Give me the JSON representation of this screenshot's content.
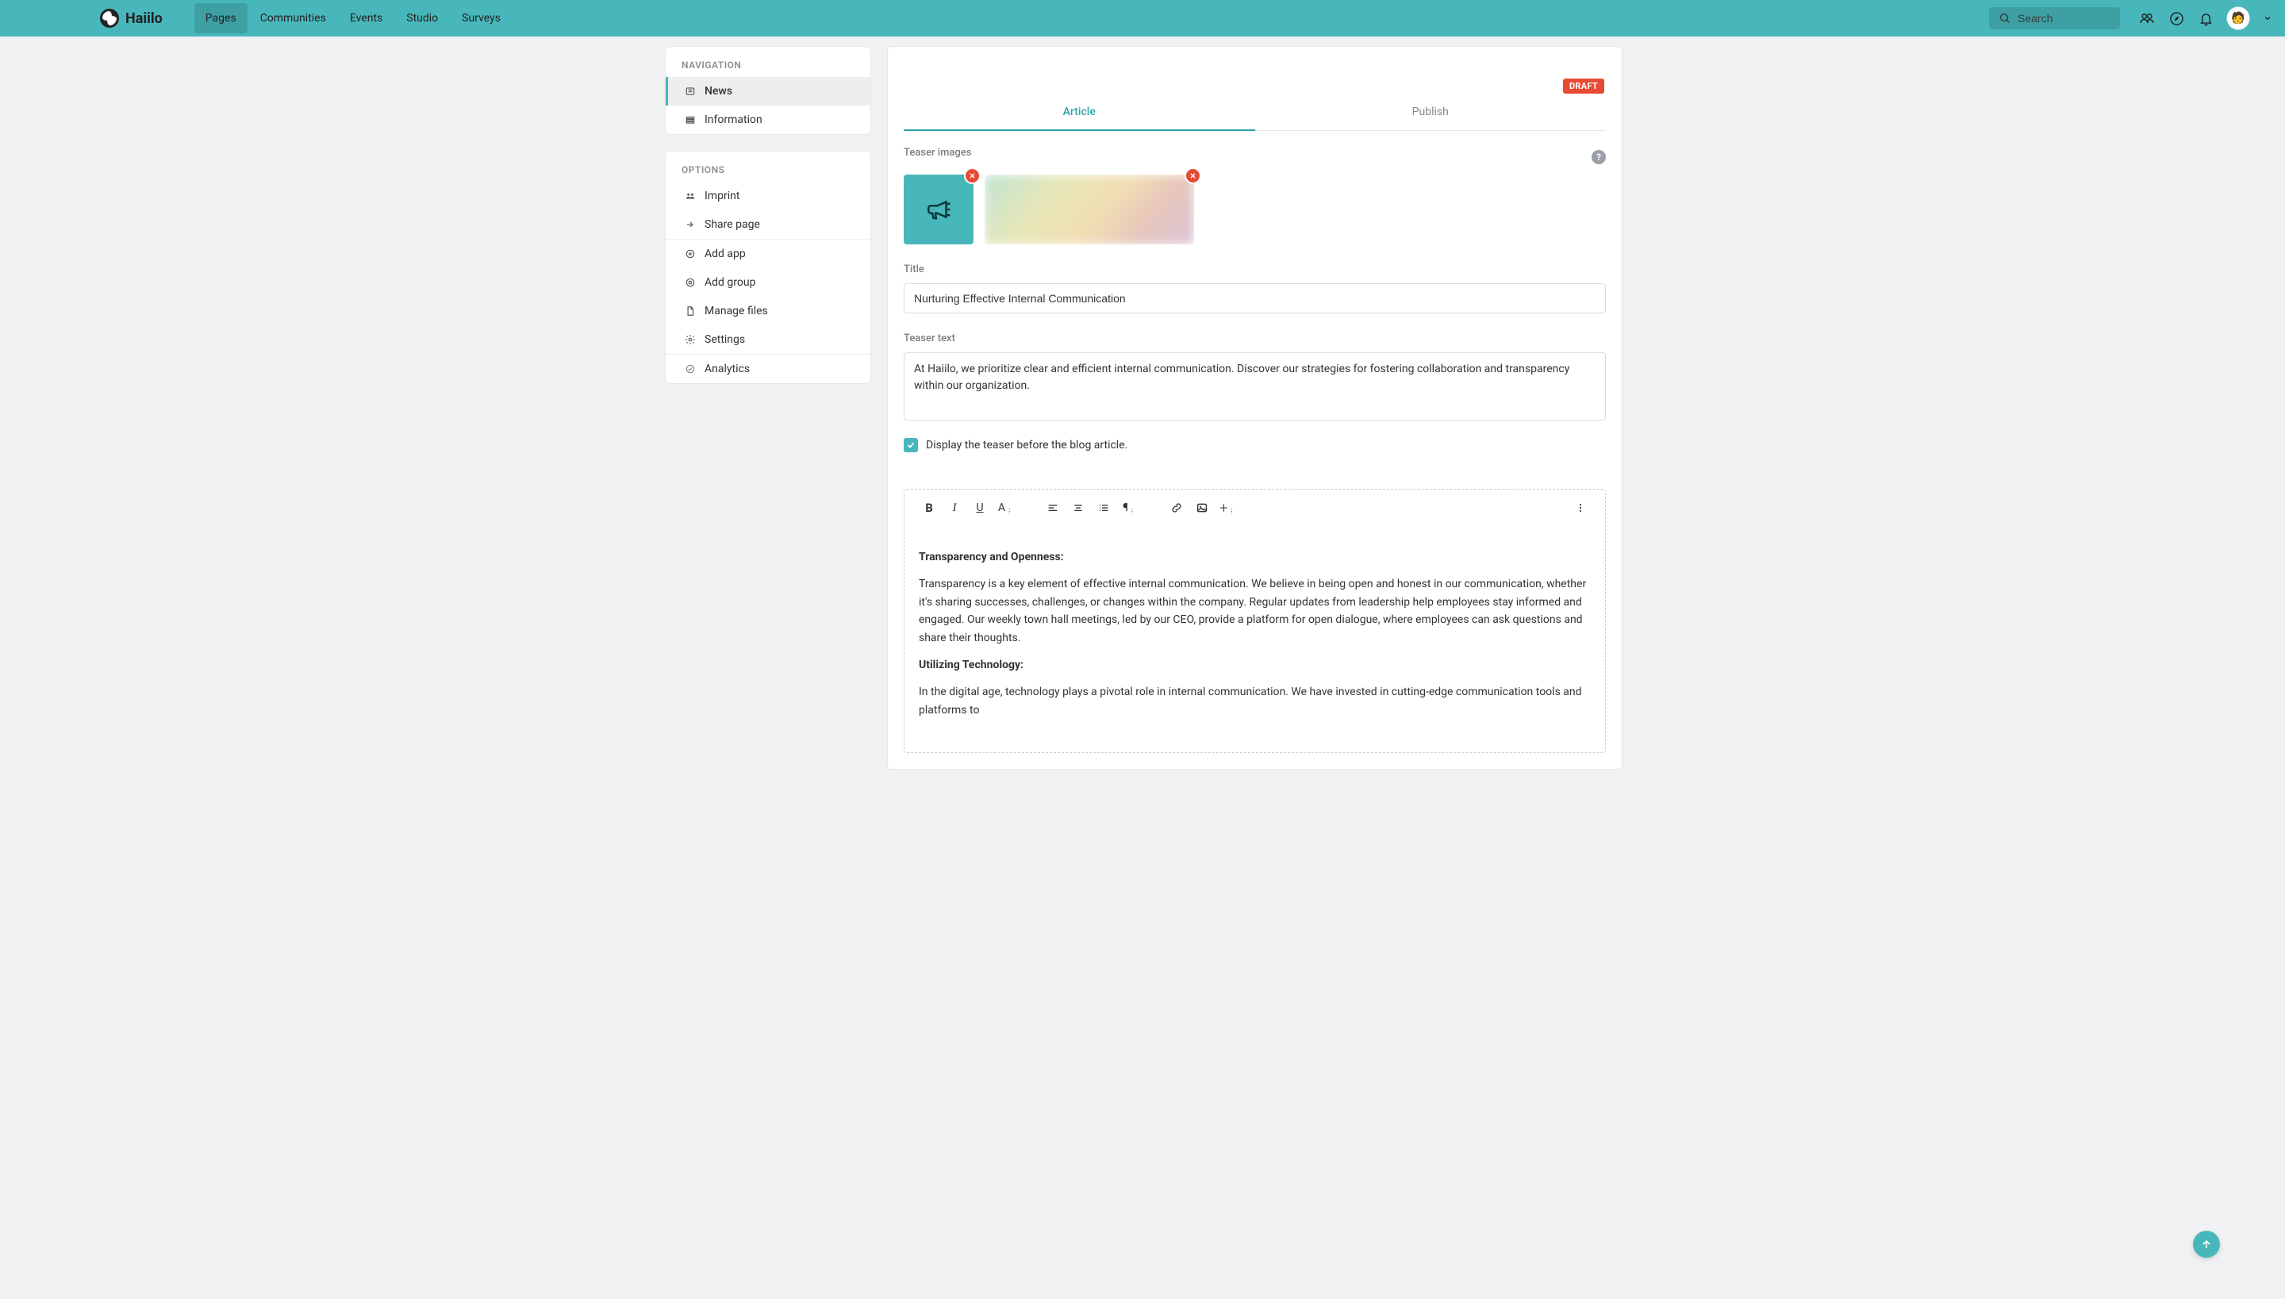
{
  "brand": "Haiilo",
  "topnav": {
    "tabs": [
      "Pages",
      "Communities",
      "Events",
      "Studio",
      "Surveys"
    ],
    "active_index": 0,
    "search_placeholder": "Search"
  },
  "sidebar": {
    "navigation": {
      "title": "NAVIGATION",
      "items": [
        {
          "label": "News",
          "icon": "news-icon"
        },
        {
          "label": "Information",
          "icon": "info-icon"
        }
      ],
      "active_index": 0
    },
    "options": {
      "title": "OPTIONS",
      "items_a": [
        {
          "label": "Imprint",
          "icon": "group-icon"
        },
        {
          "label": "Share page",
          "icon": "share-icon"
        }
      ],
      "items_b": [
        {
          "label": "Add app",
          "icon": "add-circle-icon"
        },
        {
          "label": "Add group",
          "icon": "add-circle-icon"
        },
        {
          "label": "Manage files",
          "icon": "file-icon"
        },
        {
          "label": "Settings",
          "icon": "gear-icon"
        }
      ],
      "items_c": [
        {
          "label": "Analytics",
          "icon": "check-circle-icon"
        }
      ]
    }
  },
  "main": {
    "badge": "DRAFT",
    "tabs": {
      "article": "Article",
      "publish": "Publish"
    },
    "labels": {
      "teaser_images": "Teaser images",
      "title": "Title",
      "teaser_text": "Teaser text"
    },
    "title_value": "Nurturing Effective Internal Communication",
    "teaser_value": "At Haiilo, we prioritize clear and efficient internal communication. Discover our strategies for fostering collaboration and transparency within our organization.",
    "checkbox_label": "Display the teaser before the blog article."
  },
  "editor": {
    "h1": "Transparency and Openness:",
    "p1": "Transparency is a key element of effective internal communication. We believe in being open and honest in our communication, whether it's sharing successes, challenges, or changes within the company. Regular updates from leadership help employees stay informed and engaged. Our weekly town hall meetings, led by our CEO, provide a platform for open dialogue, where employees can ask questions and share their thoughts.",
    "h2": "Utilizing Technology:",
    "p2": "In the digital age, technology plays a pivotal role in internal communication. We have invested in cutting-edge communication tools and platforms to"
  }
}
